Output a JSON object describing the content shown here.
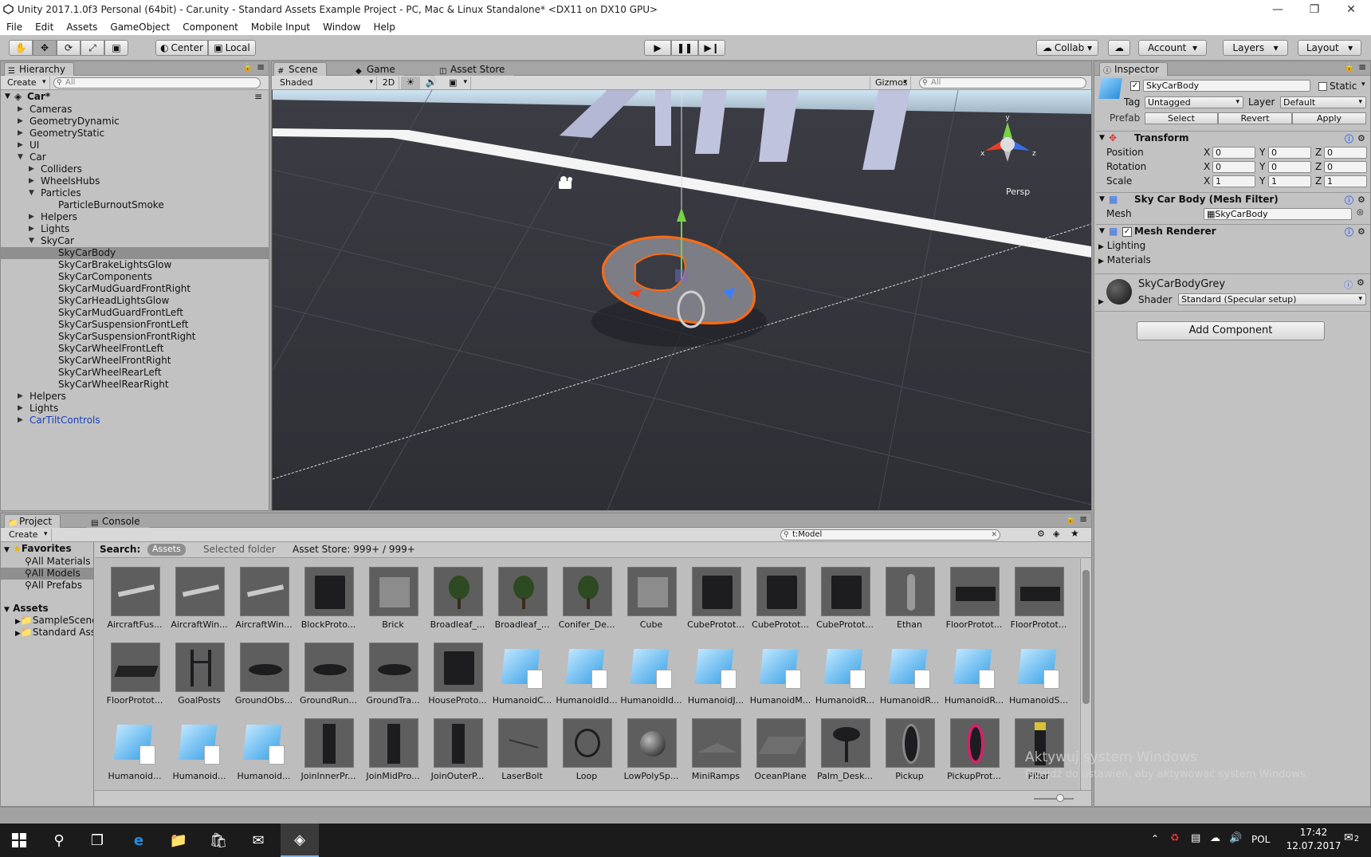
{
  "window": {
    "title": "Unity 2017.1.0f3 Personal (64bit) - Car.unity - Standard Assets Example Project - PC, Mac & Linux Standalone* <DX11 on DX10 GPU>"
  },
  "menu": [
    "File",
    "Edit",
    "Assets",
    "GameObject",
    "Component",
    "Mobile Input",
    "Window",
    "Help"
  ],
  "toolbar": {
    "pivot": "Center",
    "space": "Local",
    "collab": "Collab",
    "account": "Account",
    "layers": "Layers",
    "layout": "Layout"
  },
  "hierarchy": {
    "tab": "Hierarchy",
    "create": "Create",
    "search_placeholder": "All",
    "scene": "Car*",
    "items": [
      {
        "label": "Cameras"
      },
      {
        "label": "GeometryDynamic"
      },
      {
        "label": "GeometryStatic"
      },
      {
        "label": "UI"
      },
      {
        "label": "Car"
      },
      {
        "label": "Colliders"
      },
      {
        "label": "WheelsHubs"
      },
      {
        "label": "Particles"
      },
      {
        "label": "ParticleBurnoutSmoke"
      },
      {
        "label": "Helpers"
      },
      {
        "label": "Lights"
      },
      {
        "label": "SkyCar"
      },
      {
        "label": "SkyCarBody"
      },
      {
        "label": "SkyCarBrakeLightsGlow"
      },
      {
        "label": "SkyCarComponents"
      },
      {
        "label": "SkyCarMudGuardFrontRight"
      },
      {
        "label": "SkyCarHeadLightsGlow"
      },
      {
        "label": "SkyCarMudGuardFrontLeft"
      },
      {
        "label": "SkyCarSuspensionFrontLeft"
      },
      {
        "label": "SkyCarSuspensionFrontRight"
      },
      {
        "label": "SkyCarWheelFrontLeft"
      },
      {
        "label": "SkyCarWheelFrontRight"
      },
      {
        "label": "SkyCarWheelRearLeft"
      },
      {
        "label": "SkyCarWheelRearRight"
      },
      {
        "label": "Helpers"
      },
      {
        "label": "Lights"
      },
      {
        "label": "CarTiltControls"
      }
    ]
  },
  "scene": {
    "tabs": [
      "Scene",
      "Game",
      "Asset Store"
    ],
    "shading": "Shaded",
    "mode2d": "2D",
    "gizmos": "Gizmos",
    "search_placeholder": "All",
    "persp": "Persp",
    "axes": {
      "x": "x",
      "y": "y",
      "z": "z"
    }
  },
  "inspector": {
    "tab": "Inspector",
    "object_name": "SkyCarBody",
    "static": "Static",
    "tag_label": "Tag",
    "tag": "Untagged",
    "layer_label": "Layer",
    "layer": "Default",
    "prefab_label": "Prefab",
    "prefab_buttons": [
      "Select",
      "Revert",
      "Apply"
    ],
    "transform": {
      "title": "Transform",
      "rows": [
        {
          "label": "Position",
          "x": "0",
          "y": "0",
          "z": "0"
        },
        {
          "label": "Rotation",
          "x": "0",
          "y": "0",
          "z": "0"
        },
        {
          "label": "Scale",
          "x": "1",
          "y": "1",
          "z": "1"
        }
      ]
    },
    "axis": {
      "x": "X",
      "y": "Y",
      "z": "Z"
    },
    "mesh_filter": {
      "title": "Sky Car Body (Mesh Filter)",
      "mesh_label": "Mesh",
      "mesh": "SkyCarBody"
    },
    "mesh_renderer": {
      "title": "Mesh Renderer",
      "lighting": "Lighting",
      "materials": "Materials"
    },
    "material": {
      "name": "SkyCarBodyGrey",
      "shader_label": "Shader",
      "shader": "Standard (Specular setup)"
    },
    "add_component": "Add Component"
  },
  "project": {
    "tabs": [
      "Project",
      "Console"
    ],
    "create": "Create",
    "search_value": "t:Model",
    "search_label": "Search:",
    "scope_assets": "Assets",
    "scope_folder": "Selected folder",
    "asset_store": "Asset Store: 999+ / 999+",
    "favorites_title": "Favorites",
    "favorites": [
      "All Materials",
      "All Models",
      "All Prefabs"
    ],
    "assets_title": "Assets",
    "folders": [
      "SampleScenes",
      "Standard Assets"
    ],
    "assets": [
      "AircraftFus...",
      "AircraftWin...",
      "AircraftWin...",
      "BlockProto...",
      "Brick",
      "Broadleaf_...",
      "Broadleaf_...",
      "Conifer_De...",
      "Cube",
      "CubeProtot...",
      "CubeProtot...",
      "CubeProtot...",
      "Ethan",
      "FloorProtot...",
      "FloorProtot...",
      "FloorProtot...",
      "GoalPosts",
      "GroundObs...",
      "GroundRun...",
      "GroundTra...",
      "HouseProto...",
      "HumanoidC...",
      "HumanoidId...",
      "HumanoidId...",
      "HumanoidJ...",
      "HumanoidM...",
      "HumanoidR...",
      "HumanoidR...",
      "HumanoidR...",
      "HumanoidS...",
      "Humanoid...",
      "Humanoid...",
      "Humanoid...",
      "JoinInnerPr...",
      "JoinMidPro...",
      "JoinOuterP...",
      "LaserBolt",
      "Loop",
      "LowPolySp...",
      "MiniRamps",
      "OceanPlane",
      "Palm_Desk...",
      "Pickup",
      "PickupProt...",
      "Pillar"
    ]
  },
  "watermark": {
    "line1": "Aktywuj system Windows",
    "line2": "Przejdź do ustawień, aby aktywować system Windows."
  },
  "taskbar": {
    "lang": "POL",
    "time": "17:42",
    "date": "12.07.2017",
    "notif": "2"
  }
}
